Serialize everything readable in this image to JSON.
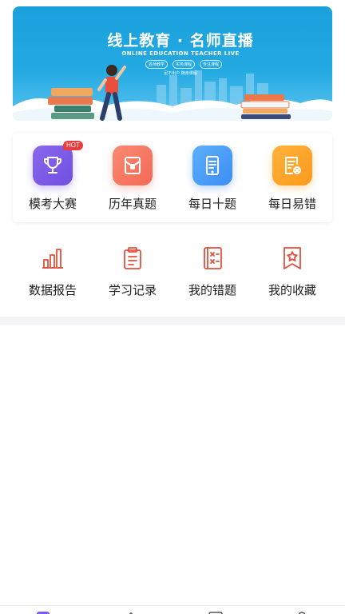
{
  "banner": {
    "title": "线上教育 · 名师直播",
    "subtitle": "ONLINE EDUCATION TEACHER LIVE",
    "tags": [
      "名师教学",
      "实务课程",
      "专注课程"
    ],
    "tag_line": "足不出户 随身课程"
  },
  "card": {
    "items": [
      {
        "label": "模考大赛",
        "icon": "trophy-icon",
        "color": "#7b5cf0",
        "badge": "HOT"
      },
      {
        "label": "历年真题",
        "icon": "folder-icon",
        "color": "#f6785f"
      },
      {
        "label": "每日十题",
        "icon": "tablet-icon",
        "color": "#4a9cf6"
      },
      {
        "label": "每日易错",
        "icon": "error-note-icon",
        "color": "#fca42c"
      }
    ]
  },
  "row2": {
    "icon_color": "#e2503d",
    "items": [
      {
        "label": "数据报告",
        "icon": "bar-chart-icon"
      },
      {
        "label": "学习记录",
        "icon": "clipboard-icon"
      },
      {
        "label": "我的错题",
        "icon": "wrong-questions-icon"
      },
      {
        "label": "我的收藏",
        "icon": "bookmark-star-icon"
      }
    ]
  }
}
